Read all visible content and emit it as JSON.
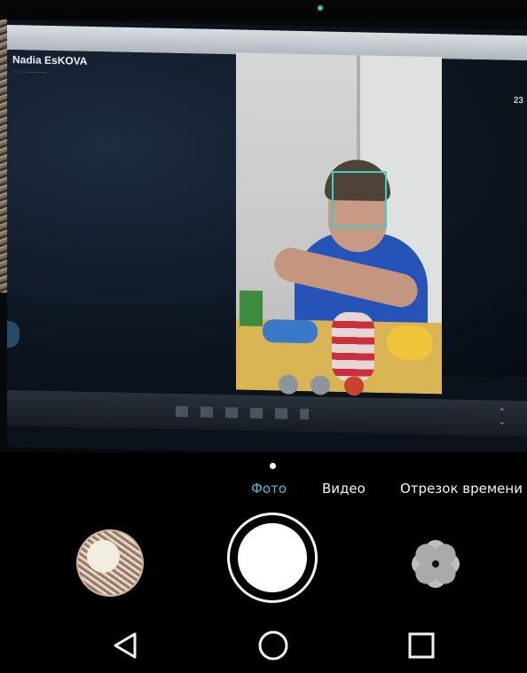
{
  "viewfinder": {
    "caller_name": "Nadia EsKOVA",
    "caller_subtitle": "··· · ·········",
    "timer": "23"
  },
  "modes": {
    "items": [
      "Фото",
      "Видео",
      "Отрезок времени"
    ],
    "selected": "Фото",
    "selected_color": "#3fc5d1"
  },
  "controls": {
    "gallery_icon": "gallery-thumbnail",
    "shutter_icon": "shutter-button",
    "effects_icon": "flower-filter-icon"
  },
  "navbar": {
    "back_icon": "back-triangle-icon",
    "home_icon": "home-circle-icon",
    "recents_icon": "recents-square-icon"
  },
  "colors": {
    "face_detect_box": "#3ed0c4",
    "end_call": "#c9422d"
  }
}
